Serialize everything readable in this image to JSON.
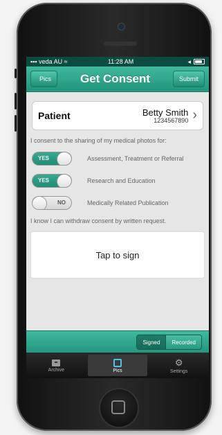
{
  "status": {
    "carrier": "veda AU",
    "time": "11:28 AM"
  },
  "nav": {
    "back_label": "Pics",
    "title": "Get Consent",
    "submit_label": "Submit"
  },
  "patient": {
    "label": "Patient",
    "name": "Betty Smith",
    "id": "1234567890"
  },
  "consent_intro": "I consent to the sharing of my medical photos for:",
  "options": [
    {
      "state": "YES",
      "label": "Assessment, Treatment or Referral"
    },
    {
      "state": "YES",
      "label": "Research and Education"
    },
    {
      "state": "NO",
      "label": "Medically Related Publication"
    }
  ],
  "withdraw_note": "I know I can withdraw consent by written request.",
  "sign_prompt": "Tap to sign",
  "segment": {
    "signed": "Signed",
    "recorded": "Recorded"
  },
  "tabs": [
    {
      "label": "Archive",
      "icon": "archive-icon"
    },
    {
      "label": "Pics",
      "icon": "pics-icon"
    },
    {
      "label": "Settings",
      "icon": "gear-icon"
    }
  ],
  "colors": {
    "accent": "#2fa88c",
    "tab_active_icon": "#4cc3e8"
  }
}
